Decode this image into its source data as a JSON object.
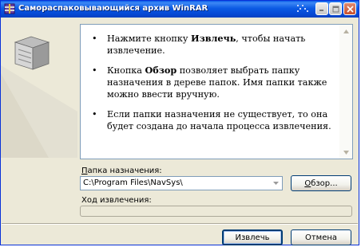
{
  "window": {
    "title": "Самораспаковывающийся архив WinRAR",
    "titlebar_color": "#0554e3"
  },
  "info": {
    "items": [
      {
        "prefix": "Нажмите кнопку ",
        "bold": "Извлечь",
        "suffix": ", чтобы начать извлечение."
      },
      {
        "prefix": "Кнопка ",
        "bold": "Обзор",
        "suffix": " позволяет выбрать папку назначения в дереве папок. Имя папки также можно ввести вручную."
      },
      {
        "prefix": "",
        "bold": "",
        "suffix": "Если папки назначения не существует, то она будет создана до начала процесса извлечения."
      }
    ],
    "bullet": "•"
  },
  "destination": {
    "label_accel": "П",
    "label_rest": "апка назначения:",
    "value": "C:\\Program Files\\NavSys\\"
  },
  "browse_button": {
    "accel": "О",
    "rest": "бзор..."
  },
  "progress": {
    "label": "Ход извлечения:",
    "value": 0
  },
  "extract_button": {
    "label": "Извлечь"
  },
  "cancel_button": {
    "label": "Отмена"
  }
}
